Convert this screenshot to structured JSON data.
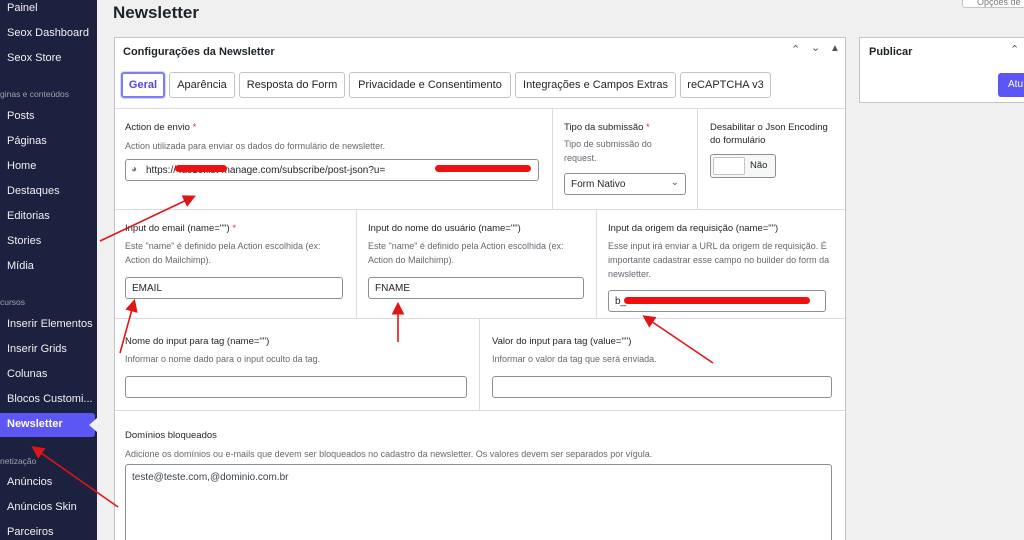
{
  "sidebar": {
    "items": [
      {
        "label": "Painel"
      },
      {
        "label": "Seox Dashboard"
      },
      {
        "label": "Seox Store"
      },
      {
        "label": "Posts"
      },
      {
        "label": "Páginas"
      },
      {
        "label": "Home"
      },
      {
        "label": "Destaques"
      },
      {
        "label": "Editorias"
      },
      {
        "label": "Stories"
      },
      {
        "label": "Mídia"
      },
      {
        "label": "Inserir Elementos"
      },
      {
        "label": "Inserir Grids"
      },
      {
        "label": "Colunas"
      },
      {
        "label": "Blocos Customi..."
      },
      {
        "label": "Newsletter"
      },
      {
        "label": "Anúncios"
      },
      {
        "label": "Anúncios Skin"
      },
      {
        "label": "Parceiros"
      }
    ],
    "sections": [
      {
        "label": "ginas e conteúdos"
      },
      {
        "label": "cursos"
      },
      {
        "label": "netização"
      }
    ]
  },
  "page": {
    "title": "Newsletter",
    "screen_options": "Opções de"
  },
  "panel": {
    "title": "Configurações da Newsletter",
    "tabs": [
      {
        "label": "Geral"
      },
      {
        "label": "Aparência"
      },
      {
        "label": "Resposta do Form"
      },
      {
        "label": "Privacidade e Consentimento"
      },
      {
        "label": "Integrações e Campos Extras"
      },
      {
        "label": "reCAPTCHA v3"
      }
    ]
  },
  "form": {
    "action": {
      "label": "Action de envio",
      "required": "*",
      "description": "Action utilizada para enviar os dados do formulário de newsletter.",
      "value": "https:// .us10.list-manage.com/subscribe/post-json?u="
    },
    "submit_type": {
      "label": "Tipo da submissão",
      "required": "*",
      "description": "Tipo de submissão do request.",
      "value": "Form Nativo"
    },
    "disable_json": {
      "label": "Desabilitar o Json Encoding do formulário",
      "toggle": "Não"
    },
    "email_input": {
      "label": "Input do email (name=\"\")",
      "required": "*",
      "description": "Este \"name\" é definido pela Action escolhida (ex: Action do Mailchimp).",
      "value": "EMAIL"
    },
    "name_input": {
      "label": "Input do nome do usuário (name=\"\")",
      "description": "Este \"name\" é definido pela Action escolhida (ex: Action do Mailchimp).",
      "value": "FNAME"
    },
    "origin_input": {
      "label": "Input da origem da requisição (name=\"\")",
      "description": "Esse input irá enviar a URL da origem de requisição. É importante cadastrar esse campo no builder do form da newsletter.",
      "value": "b_"
    },
    "tag_name": {
      "label": "Nome do input para tag (name=\"\")",
      "description": "Informar o nome dado para o input oculto da tag.",
      "value": ""
    },
    "tag_value": {
      "label": "Valor do input para tag (value=\"\")",
      "description": "Informar o valor da tag que será enviada.",
      "value": ""
    },
    "blocked": {
      "label": "Domínios bloqueados",
      "description": "Adicione os domínios ou e-mails que devem ser bloqueados no cadastro da newsletter. Os valores devem ser separados por vígula.",
      "value": "teste@teste.com,@dominio.com.br"
    }
  },
  "publish": {
    "title": "Publicar",
    "button": "Atu"
  },
  "colors": {
    "sidebar_bg": "#1d2140",
    "accent": "#5b56f4",
    "annotation": "#e01515"
  }
}
